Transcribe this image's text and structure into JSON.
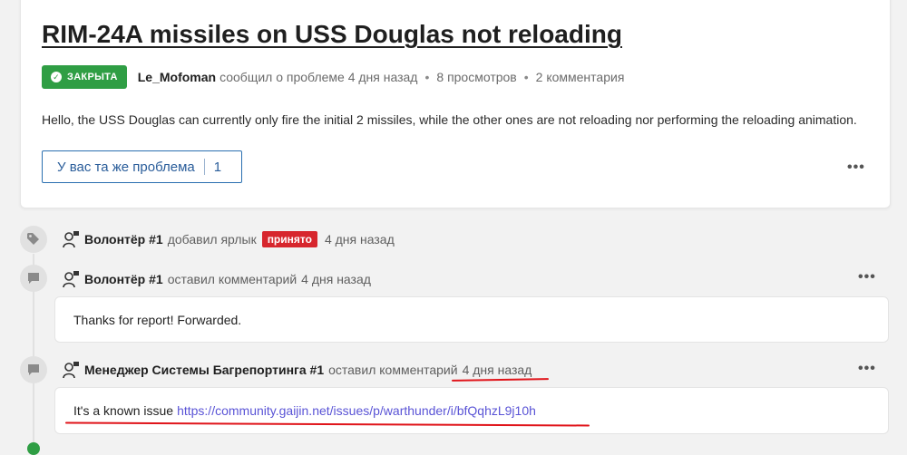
{
  "topic": {
    "title": "RIM-24A missiles on USS Douglas not reloading",
    "status_badge": "ЗАКРЫТА",
    "author": "Le_Mofoman",
    "reported_text": "сообщил о проблеме 4 дня назад",
    "views": "8 просмотров",
    "comments": "2 комментария",
    "description": "Hello, the USS Douglas can currently only fire the initial 2 missiles, while the other ones are not reloading nor performing the reloading animation.",
    "same_problem_label": "У вас та же проблема",
    "same_problem_count": "1",
    "more_label": "•••"
  },
  "timeline": [
    {
      "type": "label",
      "icon": "tag-icon",
      "user": "Волонтёр #1",
      "action": "добавил ярлык",
      "tag": "принято",
      "time": "4 дня назад"
    },
    {
      "type": "comment",
      "icon": "comment-icon",
      "user": "Волонтёр #1",
      "action": "оставил комментарий",
      "time": "4 дня назад",
      "body": "Thanks for report! Forwarded.",
      "more_label": "•••"
    },
    {
      "type": "comment",
      "icon": "comment-icon",
      "user": "Менеджер Системы Багрепортинга #1",
      "action": "оставил комментарий",
      "time": "4 дня назад",
      "body": "It's a known issue",
      "link": "https://community.gaijin.net/issues/p/warthunder/i/bfQqhzL9j10h",
      "more_label": "•••"
    }
  ],
  "colors": {
    "closed_badge": "#2f9e44",
    "accepted_tag": "#d7262d",
    "link": "#5a54d6",
    "annotation": "#e0141a"
  }
}
